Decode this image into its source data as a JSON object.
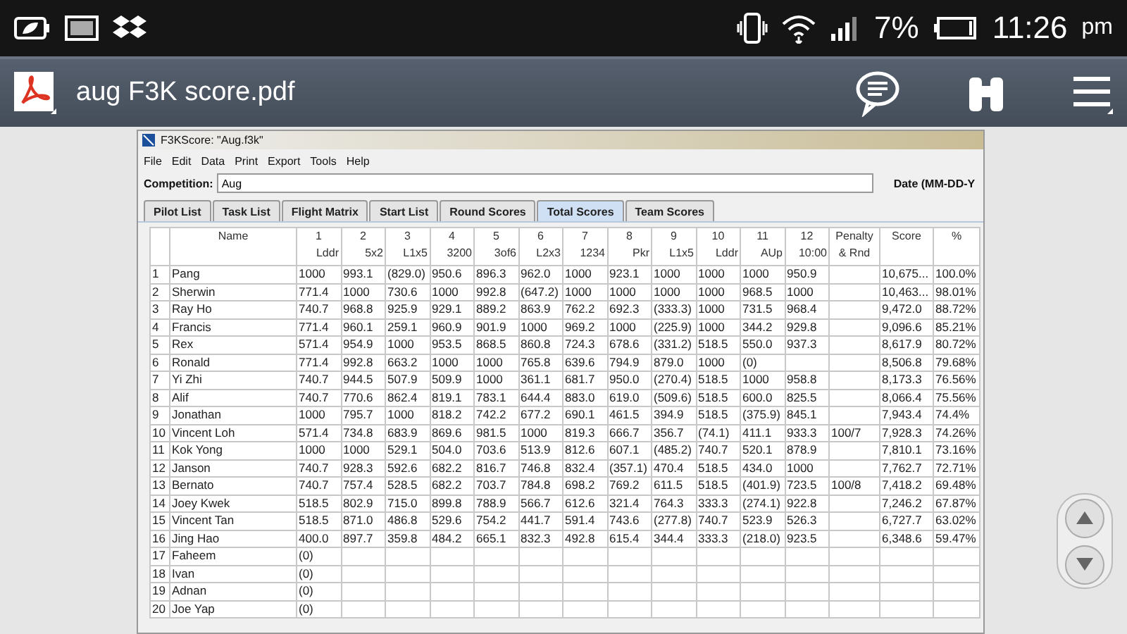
{
  "status_bar": {
    "battery_percent": "7%",
    "time": "11:26",
    "ampm": "pm"
  },
  "app_bar": {
    "title": "aug F3K score.pdf"
  },
  "window": {
    "title": "F3KScore: \"Aug.f3k\"",
    "menu": [
      "File",
      "Edit",
      "Data",
      "Print",
      "Export",
      "Tools",
      "Help"
    ],
    "competition_label": "Competition:",
    "competition_value": "Aug",
    "date_label": "Date (MM-DD-Y",
    "tabs": [
      {
        "label": "Pilot List",
        "selected": false
      },
      {
        "label": "Task List",
        "selected": false
      },
      {
        "label": "Flight Matrix",
        "selected": false
      },
      {
        "label": "Start List",
        "selected": false
      },
      {
        "label": "Round Scores",
        "selected": false
      },
      {
        "label": "Total Scores",
        "selected": true
      },
      {
        "label": "Team Scores",
        "selected": false
      }
    ]
  },
  "table": {
    "name_header": "Name",
    "penalty_header": [
      "Penalty",
      "& Rnd"
    ],
    "score_header": "Score",
    "pct_header": "%",
    "rounds": [
      {
        "number": "1",
        "task": "Lddr"
      },
      {
        "number": "2",
        "task": "5x2"
      },
      {
        "number": "3",
        "task": "L1x5"
      },
      {
        "number": "4",
        "task": "3200"
      },
      {
        "number": "5",
        "task": "3of6"
      },
      {
        "number": "6",
        "task": "L2x3"
      },
      {
        "number": "7",
        "task": "1234"
      },
      {
        "number": "8",
        "task": "Pkr"
      },
      {
        "number": "9",
        "task": "L1x5"
      },
      {
        "number": "10",
        "task": "Lddr"
      },
      {
        "number": "11",
        "task": "AUp"
      },
      {
        "number": "12",
        "task": "10:00"
      }
    ],
    "rows": [
      {
        "num": "1",
        "name": "Pang",
        "cells": [
          "1000",
          "993.1",
          "(829.0)",
          "950.6",
          "896.3",
          "962.0",
          "1000",
          "923.1",
          "1000",
          "1000",
          "1000",
          "950.9"
        ],
        "score": "10,675...",
        "pct": "100.0%"
      },
      {
        "num": "2",
        "name": "Sherwin",
        "cells": [
          "771.4",
          "1000",
          "730.6",
          "1000",
          "992.8",
          "(647.2)",
          "1000",
          "1000",
          "1000",
          "1000",
          "968.5",
          "1000"
        ],
        "score": "10,463...",
        "pct": "98.01%"
      },
      {
        "num": "3",
        "name": "Ray Ho",
        "cells": [
          "740.7",
          "968.8",
          "925.9",
          "929.1",
          "889.2",
          "863.9",
          "762.2",
          "692.3",
          "(333.3)",
          "1000",
          "731.5",
          "968.4"
        ],
        "score": "9,472.0",
        "pct": "88.72%"
      },
      {
        "num": "4",
        "name": "Francis",
        "cells": [
          "771.4",
          "960.1",
          "259.1",
          "960.9",
          "901.9",
          "1000",
          "969.2",
          "1000",
          "(225.9)",
          "1000",
          "344.2",
          "929.8"
        ],
        "score": "9,096.6",
        "pct": "85.21%"
      },
      {
        "num": "5",
        "name": "Rex",
        "cells": [
          "571.4",
          "954.9",
          "1000",
          "953.5",
          "868.5",
          "860.8",
          "724.3",
          "678.6",
          "(331.2)",
          "518.5",
          "550.0",
          "937.3"
        ],
        "score": "8,617.9",
        "pct": "80.72%"
      },
      {
        "num": "6",
        "name": "Ronald",
        "cells": [
          "771.4",
          "992.8",
          "663.2",
          "1000",
          "1000",
          "765.8",
          "639.6",
          "794.9",
          "879.0",
          "1000",
          "(0)",
          null
        ],
        "score": "8,506.8",
        "pct": "79.68%"
      },
      {
        "num": "7",
        "name": "Yi Zhi",
        "cells": [
          "740.7",
          "944.5",
          "507.9",
          "509.9",
          "1000",
          "361.1",
          "681.7",
          "950.0",
          "(270.4)",
          "518.5",
          "1000",
          "958.8"
        ],
        "score": "8,173.3",
        "pct": "76.56%"
      },
      {
        "num": "8",
        "name": "Alif",
        "cells": [
          "740.7",
          "770.6",
          "862.4",
          "819.1",
          "783.1",
          "644.4",
          "883.0",
          "619.0",
          "(509.6)",
          "518.5",
          "600.0",
          "825.5"
        ],
        "score": "8,066.4",
        "pct": "75.56%"
      },
      {
        "num": "9",
        "name": "Jonathan",
        "cells": [
          "1000",
          "795.7",
          "1000",
          "818.2",
          "742.2",
          "677.2",
          "690.1",
          "461.5",
          "394.9",
          "518.5",
          "(375.9)",
          "845.1"
        ],
        "score": "7,943.4",
        "pct": "74.4%"
      },
      {
        "num": "10",
        "name": "Vincent Loh",
        "cells": [
          "571.4",
          "734.8",
          "683.9",
          "869.6",
          "981.5",
          "1000",
          "819.3",
          "666.7",
          "356.7",
          "(74.1)",
          "411.1",
          "933.3"
        ],
        "penalty": "100/7",
        "score": "7,928.3",
        "pct": "74.26%"
      },
      {
        "num": "11",
        "name": "Kok Yong",
        "cells": [
          "1000",
          "1000",
          "529.1",
          "504.0",
          "703.6",
          "513.9",
          "812.6",
          "607.1",
          "(485.2)",
          "740.7",
          "520.1",
          "878.9"
        ],
        "score": "7,810.1",
        "pct": "73.16%"
      },
      {
        "num": "12",
        "name": "Janson",
        "cells": [
          "740.7",
          "928.3",
          "592.6",
          "682.2",
          "816.7",
          "746.8",
          "832.4",
          "(357.1)",
          "470.4",
          "518.5",
          "434.0",
          "1000"
        ],
        "score": "7,762.7",
        "pct": "72.71%"
      },
      {
        "num": "13",
        "name": "Bernato",
        "cells": [
          "740.7",
          "757.4",
          "528.5",
          "682.2",
          "703.7",
          "784.8",
          "698.2",
          "769.2",
          "611.5",
          "518.5",
          "(401.9)",
          "723.5"
        ],
        "penalty": "100/8",
        "score": "7,418.2",
        "pct": "69.48%"
      },
      {
        "num": "14",
        "name": "Joey Kwek",
        "cells": [
          "518.5",
          "802.9",
          "715.0",
          "899.8",
          "788.9",
          "566.7",
          "612.6",
          "321.4",
          "764.3",
          "333.3",
          "(274.1)",
          "922.8"
        ],
        "score": "7,246.2",
        "pct": "67.87%"
      },
      {
        "num": "15",
        "name": "Vincent Tan",
        "cells": [
          "518.5",
          "871.0",
          "486.8",
          "529.6",
          "754.2",
          "441.7",
          "591.4",
          "743.6",
          "(277.8)",
          "740.7",
          "523.9",
          "526.3"
        ],
        "score": "6,727.7",
        "pct": "63.02%"
      },
      {
        "num": "16",
        "name": "Jing Hao",
        "cells": [
          "400.0",
          "897.7",
          "359.8",
          "484.2",
          "665.1",
          "832.3",
          "492.8",
          "615.4",
          "344.4",
          "333.3",
          "(218.0)",
          "923.5"
        ],
        "score": "6,348.6",
        "pct": "59.47%"
      },
      {
        "num": "17",
        "name": "Faheem",
        "cells": [
          "(0)"
        ]
      },
      {
        "num": "18",
        "name": "Ivan",
        "cells": [
          "(0)"
        ]
      },
      {
        "num": "19",
        "name": "Adnan",
        "cells": [
          "(0)"
        ]
      },
      {
        "num": "20",
        "name": "Joe Yap",
        "cells": [
          "(0)"
        ]
      }
    ]
  }
}
